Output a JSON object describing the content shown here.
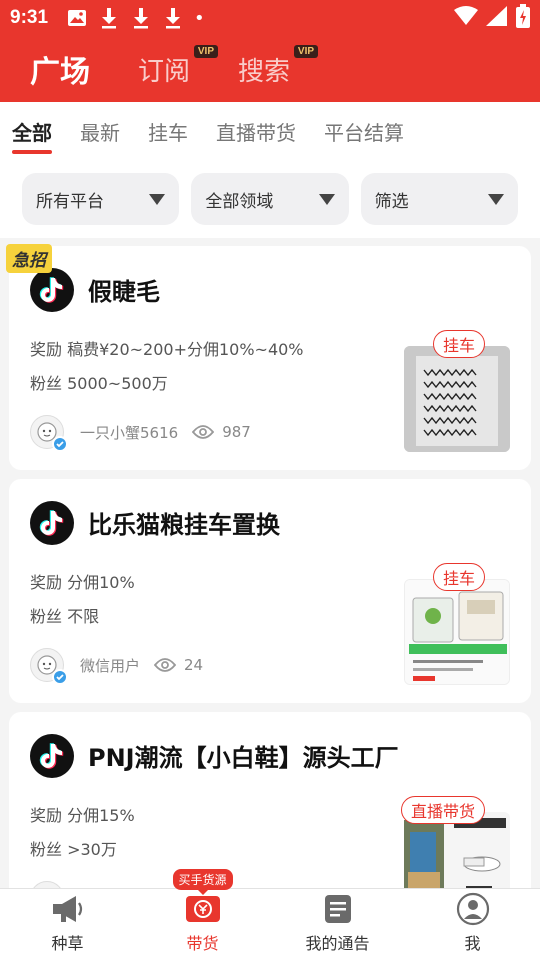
{
  "status_bar": {
    "time": "9:31",
    "dot": "•",
    "icons": [
      "image-icon",
      "download-icon",
      "download-icon",
      "download-icon",
      "wifi-icon",
      "signal-icon",
      "battery-icon"
    ]
  },
  "header": {
    "tabs": [
      {
        "label": "广场",
        "active": true,
        "vip": ""
      },
      {
        "label": "订阅",
        "active": false,
        "vip": "VIP"
      },
      {
        "label": "搜索",
        "active": false,
        "vip": "VIP"
      }
    ]
  },
  "sub_tabs": [
    "全部",
    "最新",
    "挂车",
    "直播带货",
    "平台结算"
  ],
  "filters": [
    "所有平台",
    "全部领域",
    "筛选"
  ],
  "cards": [
    {
      "badge": "急招",
      "title": "假睫毛",
      "reward": "奖励 稿费¥20~200+分佣10%~40%",
      "fans": "粉丝 5000~500万",
      "author": "一只小蟹5616",
      "views": "987",
      "tag": "挂车"
    },
    {
      "badge": "",
      "title": "比乐猫粮挂车置换",
      "reward": "奖励 分佣10%",
      "fans": "粉丝 不限",
      "author": "微信用户",
      "views": "24",
      "tag": "挂车"
    },
    {
      "badge": "",
      "title": "PNJ潮流【小白鞋】源头工厂",
      "reward": "奖励 分佣15%",
      "fans": "粉丝 >30万",
      "author": "",
      "views": "",
      "tag": "直播带货"
    }
  ],
  "bottom_nav": {
    "items": [
      {
        "label": "种草",
        "icon": "megaphone-icon",
        "active": false
      },
      {
        "label": "带货",
        "icon": "yuan-cart-icon",
        "active": true
      },
      {
        "label": "我的通告",
        "icon": "notice-icon",
        "active": false
      },
      {
        "label": "我",
        "icon": "profile-icon",
        "active": false
      }
    ],
    "badge": "买手货源"
  },
  "colors": {
    "brand": "#e8362d",
    "verified": "#3a9ee8",
    "urgent": "#f6d23c"
  }
}
